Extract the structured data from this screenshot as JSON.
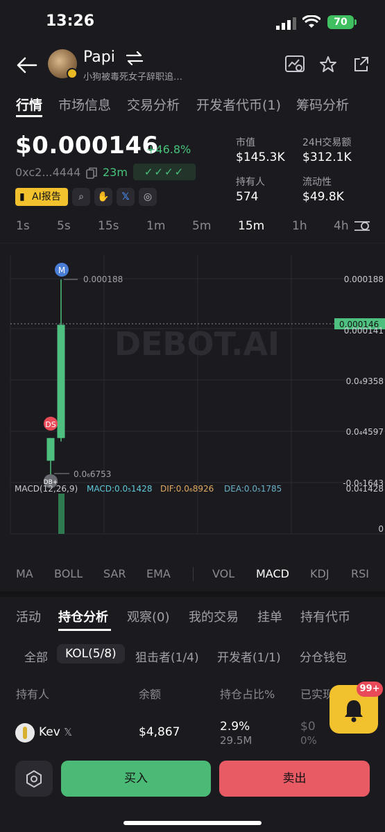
{
  "status_bar": {
    "time": "13:26",
    "battery": "70"
  },
  "header": {
    "name": "Papi",
    "subtitle": "小狗被毒死女子辞职追…"
  },
  "tabs": [
    "行情",
    "市场信息",
    "交易分析",
    "开发者代币(1)",
    "筹码分析"
  ],
  "price": {
    "value": "$0.000146",
    "change": "+46.8%",
    "address": "0xc2...4444",
    "age": "23m",
    "checks": "✓✓✓✓"
  },
  "stats": [
    {
      "label": "市值",
      "value": "$145.3K"
    },
    {
      "label": "24H交易额",
      "value": "$312.1K"
    },
    {
      "label": "持有人",
      "value": "574"
    },
    {
      "label": "流动性",
      "value": "$49.8K"
    }
  ],
  "tools": {
    "ai_label": "AI报告"
  },
  "timeframes": [
    "1s",
    "5s",
    "15s",
    "1m",
    "5m",
    "15m",
    "1h",
    "4h"
  ],
  "chart": {
    "watermark": "DEBOT.AI",
    "high_label": "0.000188",
    "low_label": "0.0₆6753",
    "current_price_tag": "0.000146",
    "axis_labels": [
      "0.000188",
      "0.000141",
      "0.0₄9358",
      "0.0₄4597",
      "-0.0₅1643",
      "0.0₄1428",
      "0"
    ],
    "markers": {
      "m": "M",
      "ds": "DS",
      "db": "DB+"
    },
    "macd_label": "MACD(12,26,9)",
    "macd_value": "MACD:0.0₅1428",
    "dif_value": "DIF:0.0₆8926",
    "dea_value": "DEA:0.0₅1785",
    "colors": {
      "up": "#4fbf7f",
      "down": "#e84a57",
      "macd": "#5fc8d8",
      "dif": "#e0a860",
      "dea": "#6ab0c8"
    }
  },
  "chart_data": {
    "type": "candlestick",
    "candles": [
      {
        "open": 2.02e-05,
        "close": 4.12e-05,
        "high": 4.12e-05,
        "low": 6.7e-06
      },
      {
        "open": 4.12e-05,
        "close": 0.000146,
        "high": 0.000188,
        "low": 3.8e-05
      }
    ],
    "ylim": [
      0,
      0.000188
    ]
  },
  "indicators": [
    "MA",
    "BOLL",
    "SAR",
    "EMA",
    "VOL",
    "MACD",
    "KDJ",
    "RSI"
  ],
  "sub_tabs": [
    "活动",
    "持仓分析",
    "观察(0)",
    "我的交易",
    "挂单",
    "持有代币"
  ],
  "chips": [
    "全部",
    "KOL(5/8)",
    "狙击者(1/4)",
    "开发者(1/1)",
    "分仓钱包"
  ],
  "table": {
    "headers": [
      "持有人",
      "余额",
      "持仓占比%",
      "已实现"
    ],
    "rows": [
      {
        "name": "Kev",
        "balance": "$4,867",
        "pct": "2.9%",
        "pct_sub": "29.5M",
        "realized": "$0",
        "realized_sub": "0%"
      }
    ]
  },
  "notification_badge": "99+",
  "actions": {
    "buy": "买入",
    "sell": "卖出"
  }
}
